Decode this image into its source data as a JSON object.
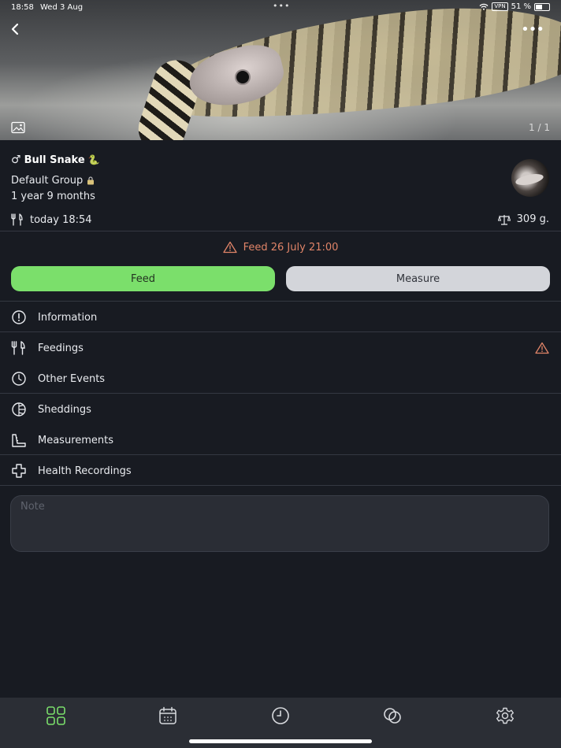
{
  "status_bar": {
    "time": "18:58",
    "date": "Wed 3 Aug",
    "dots": "•••",
    "vpn": "VPN",
    "battery": "51 %"
  },
  "hero": {
    "page_counter": "1 / 1"
  },
  "pet": {
    "gender_symbol": "♂",
    "name": "Bull Snake",
    "name_emoji": "🐍",
    "group": "Default Group",
    "age": "1 year 9 months",
    "last_feed": "today 18:54",
    "weight": "309 g."
  },
  "alert": {
    "text": "Feed 26 July 21:00",
    "color": "#e08468"
  },
  "actions": {
    "feed_label": "Feed",
    "measure_label": "Measure",
    "feed_color": "#7bdf6b"
  },
  "menu": [
    {
      "label": "Information",
      "icon": "info-circle-icon"
    },
    {
      "label": "Feedings",
      "icon": "fork-knife-icon"
    },
    {
      "label": "Other Events",
      "icon": "clock-icon"
    },
    {
      "label": "Sheddings",
      "icon": "shedding-icon"
    },
    {
      "label": "Measurements",
      "icon": "measurement-icon"
    },
    {
      "label": "Health Recordings",
      "icon": "plus-cross-icon"
    }
  ],
  "note": {
    "placeholder": "Note"
  },
  "tabbar": [
    {
      "name": "grid-icon",
      "active": true
    },
    {
      "name": "calendar-icon",
      "active": false
    },
    {
      "name": "clock-icon",
      "active": false
    },
    {
      "name": "rings-icon",
      "active": false
    },
    {
      "name": "gear-icon",
      "active": false
    }
  ],
  "colors": {
    "background": "#181b22",
    "active_tab": "#7bdf6b",
    "warning": "#e08468"
  }
}
